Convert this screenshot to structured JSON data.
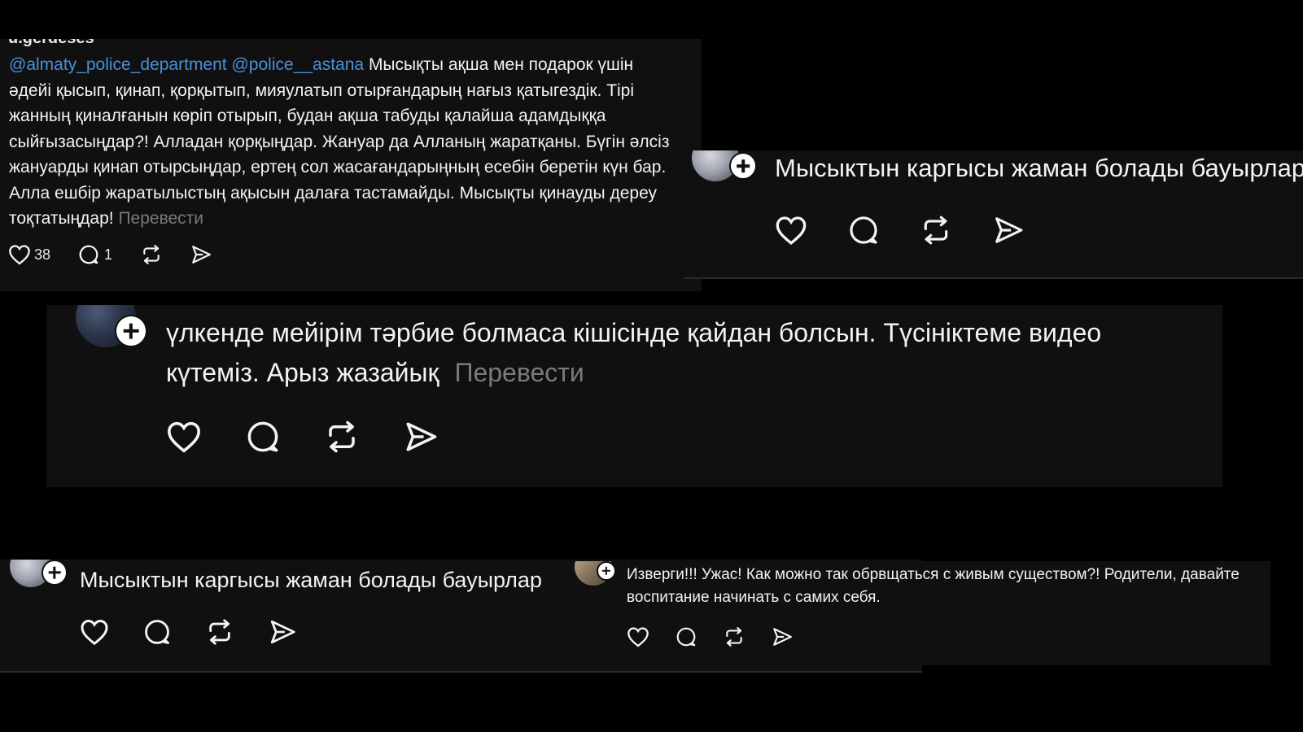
{
  "post1": {
    "username_fragment": "u.gerdeses",
    "mentions": [
      "@almaty_police_department",
      "@police__astana"
    ],
    "text": "Мысықты ақша мен подарок үшін әдейі қысып, қинап, қорқытып, мияулатып отырғандарың нағыз қатыгездік. Тірі жанның қиналғанын көріп отырып, будан ақша табуды қалайша адамдыққа сыйғызасыңдар?! Алладан қорқыңдар. Жануар да Алланың жаратқаны. Бүгін әлсіз жануарды қинап отырсыңдар, ертең сол жасағандарыңның есебін беретін күн бар. Алла ешбір жаратылыстың ақысын далаға тастамайды. Мысықты қинауды дереу тоқтатыңдар!",
    "translate": "Перевести",
    "likes": "38",
    "replies": "1"
  },
  "post2": {
    "text": "Мысыктын каргысы жаман болады бауырлар"
  },
  "post3": {
    "text": "үлкенде мейірім тәрбие болмаса кішісінде қайдан болсын. Түсініктеме видео күтеміз. Арыз жазайық",
    "translate": "Перевести"
  },
  "post4": {
    "text": "Мысыктын каргысы жаман болады бауырлар"
  },
  "post5": {
    "text": "Изверги!!! Ужас! Как можно так обрвщаться с живым существом?! Родители, давайте воспитание начинать с самих себя."
  },
  "icons": [
    "heart-icon",
    "comment-icon",
    "repost-icon",
    "share-icon",
    "follow-plus-icon"
  ],
  "colors": {
    "background": "#000000",
    "card": "#101010",
    "mention": "#4a90d9",
    "translate": "#7a7a7a",
    "text": "#f3f3f3"
  }
}
